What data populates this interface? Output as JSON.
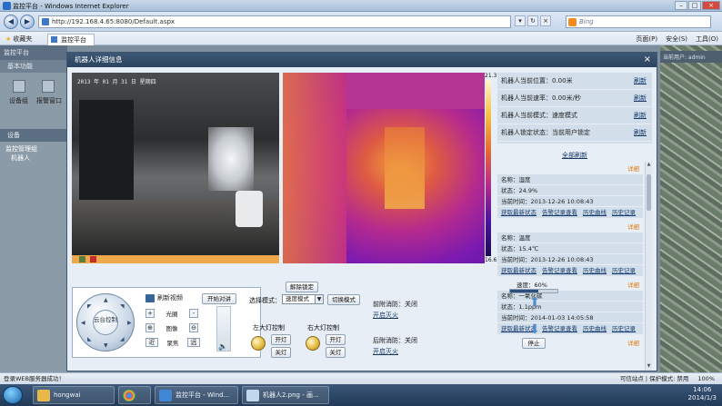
{
  "browser": {
    "title": "监控平台 - Windows Internet Explorer",
    "url": "http://192.168.4.65:8080/Default.aspx",
    "search_placeholder": "Bing",
    "favorites": "收藏夹",
    "tab": "监控平台",
    "cmd": [
      "页面(P)",
      "安全(S)",
      "工具(O)"
    ],
    "status_left": "登录WEB服务器成功！",
    "status_zone": "可信站点 | 保护模式: 禁用",
    "zoom": "100%"
  },
  "left_pane": {
    "header": "监控平台",
    "sub": "基本功能",
    "icons": [
      "设备组",
      "报警窗口"
    ],
    "section": "设备",
    "tree": [
      "监控管理组",
      "机器人"
    ],
    "user": "当前用户: admin"
  },
  "modal": {
    "title": "机器人详细信息",
    "close": "×",
    "cam_osd": "2013 年 01 月 31 日 星期四",
    "thermal_max": "21.3",
    "thermal_min": "16.6",
    "status_rows": [
      {
        "label": "机器人当前位置：0.00米",
        "action": "刷新"
      },
      {
        "label": "机器人当前速率：0.00米/秒",
        "action": "刷新"
      },
      {
        "label": "机器人当前模式：速度模式",
        "action": "刷新"
      },
      {
        "label": "机器人锁定状态：当前用户锁定",
        "action": "刷新"
      }
    ],
    "refresh_all": "全部刷新",
    "detail": "详细",
    "sensors": [
      {
        "name": "名称：湿度",
        "state": "状态：24.9%",
        "time": "当前时间：2013-12-26 10:08:43"
      },
      {
        "name": "名称：温度",
        "state": "状态：15.4℃",
        "time": "当前时间：2013-12-26 10:08:43"
      },
      {
        "name": "名称：一氧化碳",
        "state": "状态：1.1ppm",
        "time": "当前时间：2014-01-03 14:05:58"
      }
    ],
    "sensor_links": [
      "获取最新状态",
      "告警记录查看",
      "历史曲线",
      "历史记录"
    ],
    "controls": {
      "center": "云台控制",
      "refresh_video": "刷新视频",
      "aperture": "光圈",
      "zoom": "图像",
      "focus": "聚焦",
      "near": "近",
      "far": "远",
      "intercom": "开始对讲",
      "unlock": "解除锁定",
      "mode_label": "选择模式：",
      "mode_value": "速度模式",
      "switch_mode": "切换模式",
      "front_fire": "前附消防：关闭",
      "rear_fire": "后附消防：关闭",
      "open_fire": "开启灭火",
      "left_lamp": "左大灯控制",
      "right_lamp": "右大灯控制",
      "on": "开灯",
      "off": "关灯",
      "speed_label": "速度：60%",
      "speed_value": 0.6,
      "stop": "停止"
    }
  },
  "taskbar": {
    "items": [
      "hongwai",
      "",
      "监控平台 - Wind...",
      "机器人2.png - 画..."
    ],
    "time": "14:06",
    "date": "2014/1/3"
  }
}
